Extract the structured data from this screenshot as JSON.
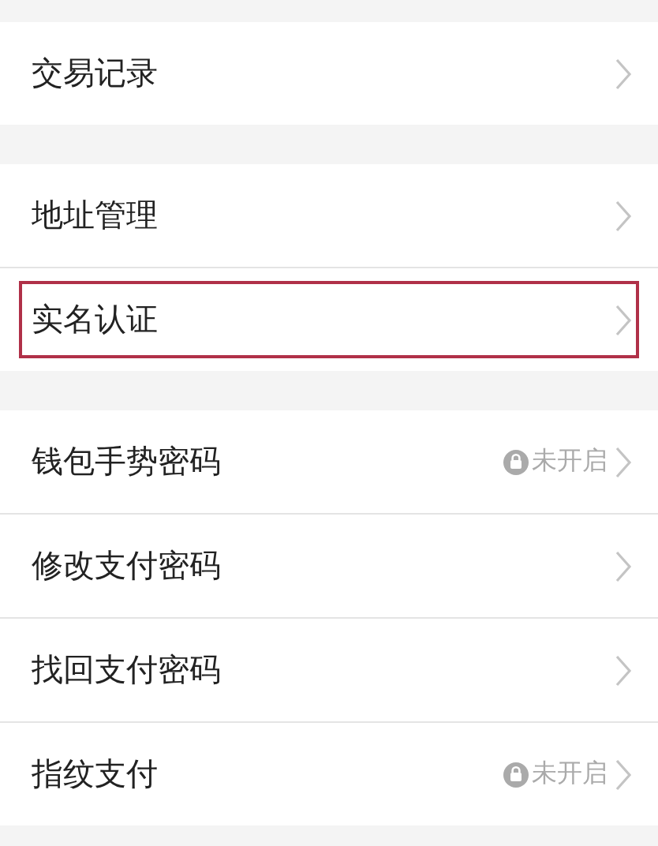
{
  "groups": [
    {
      "items": [
        {
          "label": "交易记录",
          "highlighted": false
        }
      ]
    },
    {
      "items": [
        {
          "label": "地址管理",
          "highlighted": false
        },
        {
          "label": "实名认证",
          "highlighted": true
        }
      ]
    },
    {
      "items": [
        {
          "label": "钱包手势密码",
          "status": "未开启",
          "highlighted": false
        },
        {
          "label": "修改支付密码",
          "highlighted": false
        },
        {
          "label": "找回支付密码",
          "highlighted": false
        },
        {
          "label": "指纹支付",
          "status": "未开启",
          "highlighted": false
        }
      ]
    }
  ]
}
